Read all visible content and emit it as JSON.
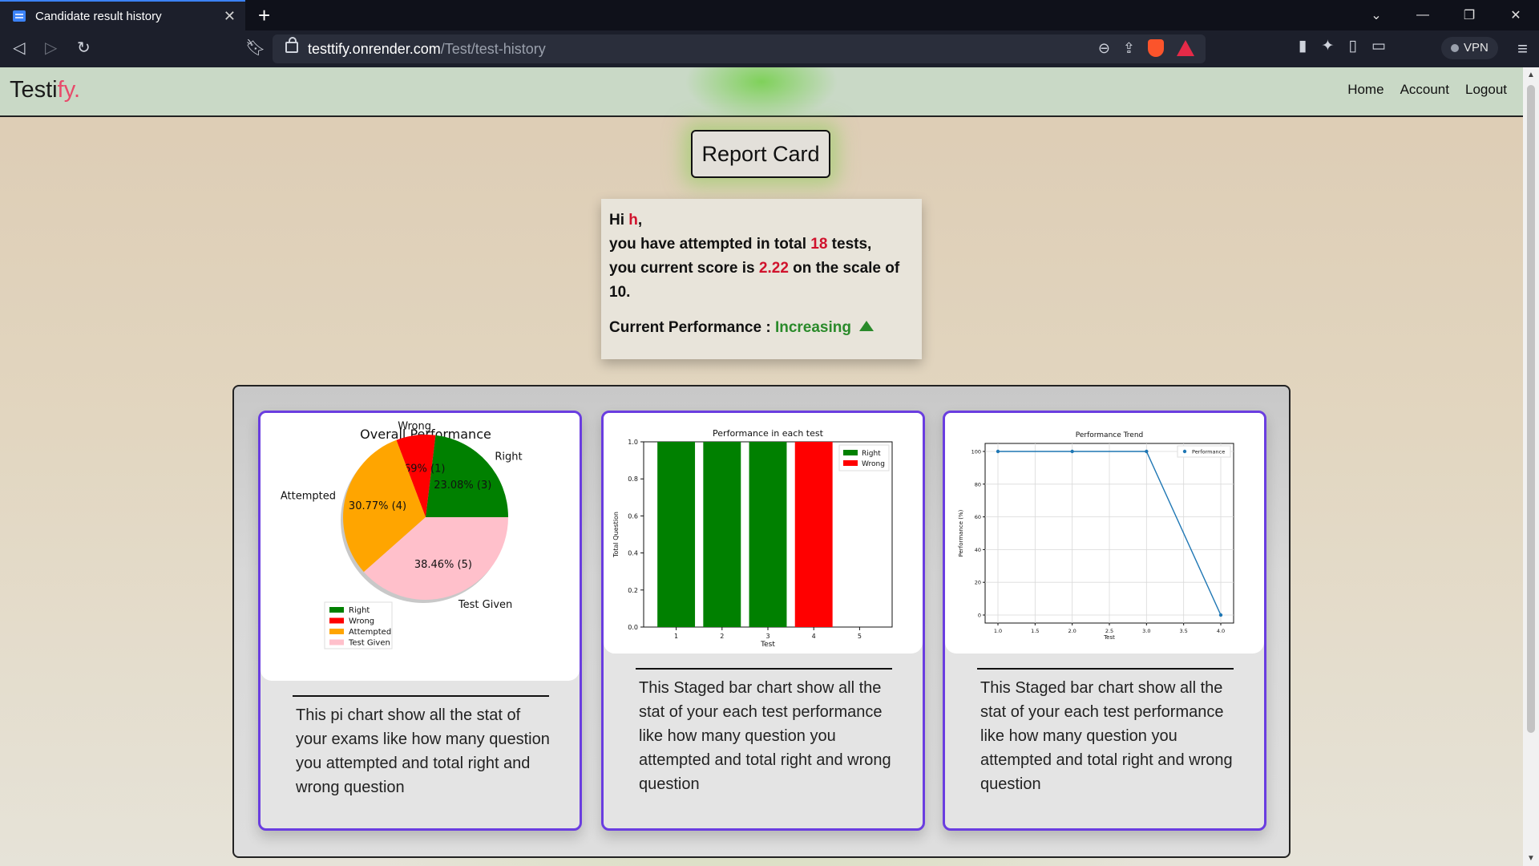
{
  "browser": {
    "tab_title": "Candidate result history",
    "url_host": "testtify.onrender.com",
    "url_path": "/Test/test-history",
    "vpn_label": "VPN"
  },
  "navbar": {
    "brand_main": "Testi",
    "brand_accent": "fy.",
    "links": [
      "Home",
      "Account",
      "Logout"
    ]
  },
  "report": {
    "title": "Report Card",
    "greeting_prefix": "Hi ",
    "user_name": "h",
    "greeting_suffix": ",",
    "attempted_prefix": "you have attempted in total ",
    "total_tests": "18",
    "attempted_suffix": " tests,",
    "score_prefix": "you current score is ",
    "score": "2.22",
    "score_suffix": " on the scale of",
    "scale": "10.",
    "performance_label": "Current Performance : ",
    "performance_value": "Increasing",
    "colors": {
      "highlight": "#d0122c",
      "increasing": "#2a8a2a",
      "card_border": "#6a3de0"
    }
  },
  "cards": [
    {
      "description": "This pi chart show all the stat of your exams like how many question you attempted and total right and wrong question"
    },
    {
      "description": "This Staged bar chart show all the stat of your each test performance like how many question you attempted and total right and wrong question"
    },
    {
      "description": "This Staged bar chart show all the stat of your each test performance like how many question you attempted and total right and wrong question"
    }
  ],
  "chart_data": [
    {
      "type": "pie",
      "title": "Overall Performance",
      "slices": [
        {
          "label": "Right",
          "value": 23.08,
          "count": 3,
          "text": "23.08% (3)",
          "color": "#008000"
        },
        {
          "label": "Wrong",
          "value": 7.69,
          "count": 1,
          "text": "7.69% (1)",
          "color": "#ff0000"
        },
        {
          "label": "Attempted",
          "value": 30.77,
          "count": 4,
          "text": "30.77% (4)",
          "color": "#ffa500"
        },
        {
          "label": "Test Given",
          "value": 38.46,
          "count": 5,
          "text": "38.46% (5)",
          "color": "#ffc0cb"
        }
      ],
      "legend": [
        "Right",
        "Wrong",
        "Attempted",
        "Test Given"
      ],
      "legend_position": "lower-left"
    },
    {
      "type": "bar",
      "title": "Performance in each test",
      "xlabel": "Test",
      "ylabel": "Total Question",
      "categories": [
        "1",
        "2",
        "3",
        "4",
        "5"
      ],
      "series": [
        {
          "name": "Right",
          "color": "#008000",
          "values": [
            1,
            1,
            1,
            0,
            0
          ]
        },
        {
          "name": "Wrong",
          "color": "#ff0000",
          "values": [
            0,
            0,
            0,
            1,
            0
          ]
        }
      ],
      "ylim": [
        0,
        1.0
      ],
      "yticks": [
        "0.0",
        "0.2",
        "0.4",
        "0.6",
        "0.8",
        "1.0"
      ],
      "legend_position": "upper-right"
    },
    {
      "type": "line",
      "title": "Performance Trend",
      "xlabel": "Test",
      "ylabel": "Performance (%)",
      "series": [
        {
          "name": "Performance",
          "color": "#1f77b4",
          "x": [
            1.0,
            2.0,
            3.0,
            4.0
          ],
          "y": [
            100,
            100,
            100,
            0
          ]
        }
      ],
      "xlim": [
        1.0,
        4.0
      ],
      "ylim": [
        0,
        100
      ],
      "xticks": [
        "1.0",
        "1.5",
        "2.0",
        "2.5",
        "3.0",
        "3.5",
        "4.0"
      ],
      "yticks": [
        "0",
        "20",
        "40",
        "60",
        "80",
        "100"
      ],
      "grid": true,
      "legend_position": "upper-right"
    }
  ]
}
